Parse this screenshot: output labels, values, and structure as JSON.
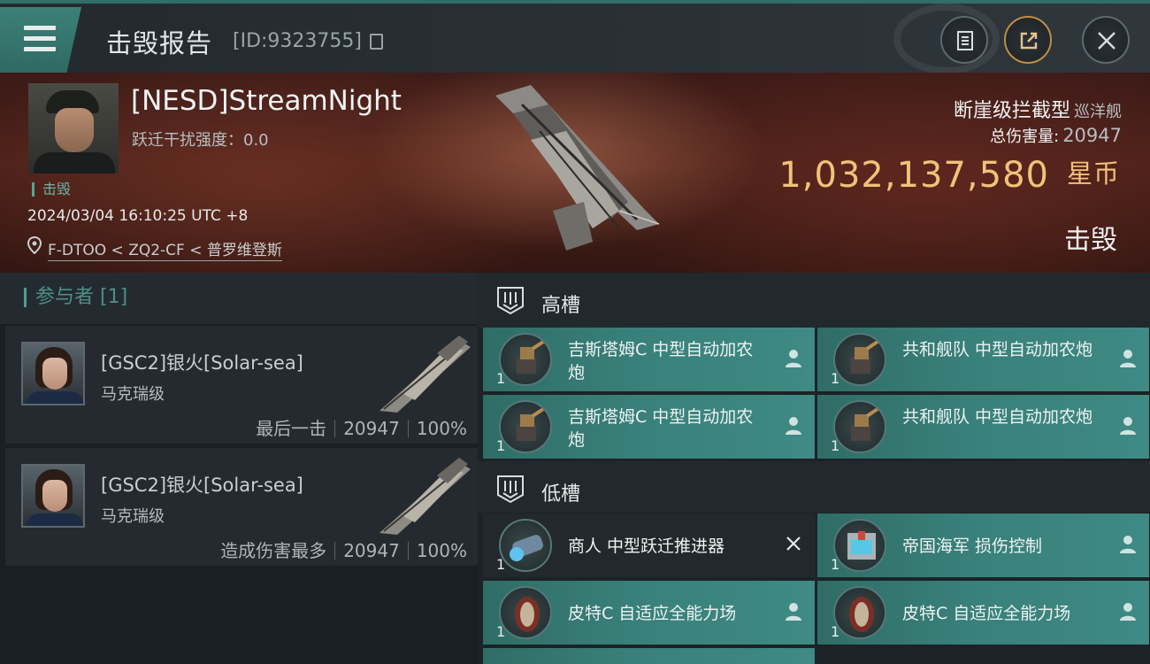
{
  "header": {
    "title": "击毁报告",
    "report_id": "[ID:9323755]"
  },
  "victim": {
    "pilot_name": "[NESD]StreamNight",
    "warp_disruption": "跃迁干扰强度：0.0",
    "status": "击毁",
    "datetime": "2024/03/04 16:10:25 UTC +8",
    "location": "F-DTOO < ZQ2-CF < 普罗维登斯",
    "ship_name": "断崖级拦截型",
    "ship_type": "巡洋舰",
    "total_damage_label": "总伤害量:",
    "total_damage": "20947",
    "isk_value": "1,032,137,580",
    "isk_unit": "星币",
    "result": "击毁"
  },
  "participants": {
    "header": "参与者 [1]",
    "rows": [
      {
        "name": "[GSC2]银火[Solar-sea]",
        "ship": "马克瑞级",
        "role": "最后一击",
        "damage": "20947",
        "percent": "100%"
      },
      {
        "name": "[GSC2]银火[Solar-sea]",
        "ship": "马克瑞级",
        "role": "造成伤害最多",
        "damage": "20947",
        "percent": "100%"
      }
    ]
  },
  "fitting": {
    "high_label": "高槽",
    "low_label": "低槽",
    "high": [
      {
        "name": "吉斯塔姆C 中型自动加农炮",
        "qty": "1",
        "state": "destroyed"
      },
      {
        "name": "共和舰队 中型自动加农炮",
        "qty": "1",
        "state": "destroyed"
      },
      {
        "name": "吉斯塔姆C 中型自动加农炮",
        "qty": "1",
        "state": "destroyed"
      },
      {
        "name": "共和舰队 中型自动加农炮",
        "qty": "1",
        "state": "destroyed"
      }
    ],
    "low": [
      {
        "name": "商人 中型跃迁推进器",
        "qty": "1",
        "state": "dropped"
      },
      {
        "name": "帝国海军 损伤控制",
        "qty": "1",
        "state": "destroyed"
      },
      {
        "name": "皮特C 自适应全能力场",
        "qty": "1",
        "state": "destroyed"
      },
      {
        "name": "皮特C 自适应全能力场",
        "qty": "1",
        "state": "destroyed"
      }
    ]
  },
  "colors": {
    "accent": "#3d8078",
    "isk": "#f1c27a",
    "slot_fill": "#39807a"
  }
}
